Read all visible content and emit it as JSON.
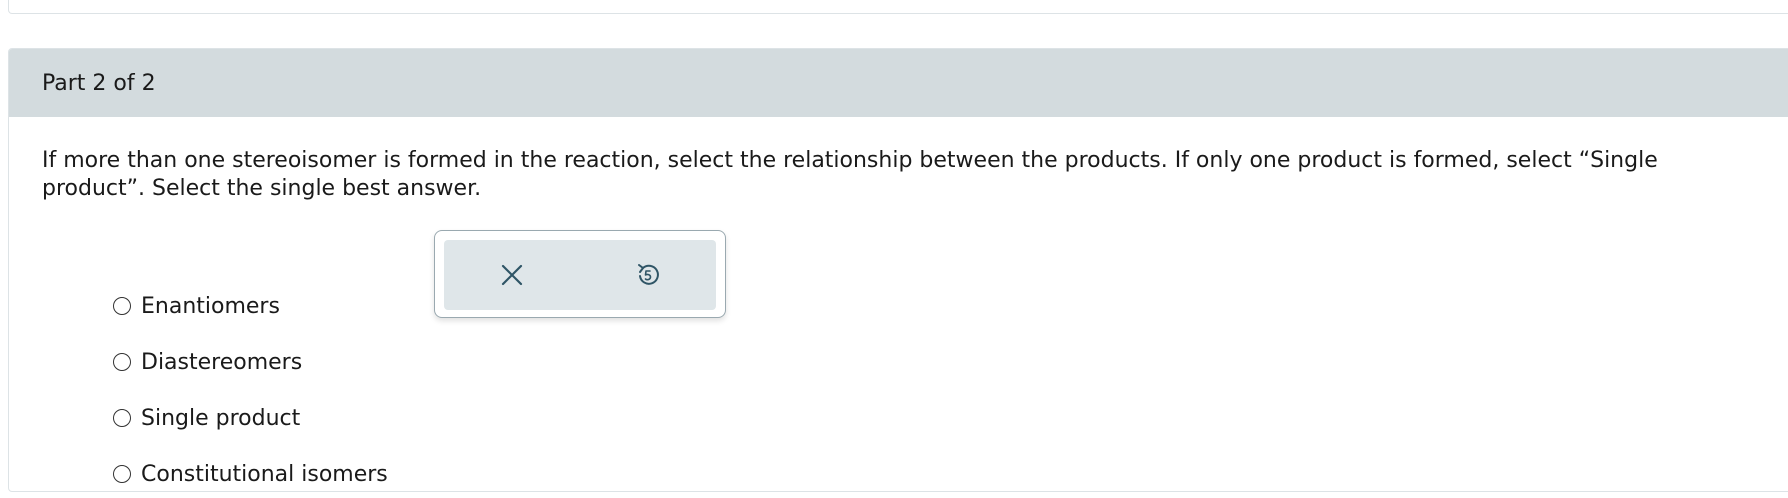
{
  "part": {
    "header": "Part 2 of 2"
  },
  "question": {
    "text": "If more than one stereoisomer is formed in the reaction, select the relationship between the products. If only one product is formed, select “Single product”. Select the single best answer."
  },
  "options": [
    {
      "label": "Enantiomers"
    },
    {
      "label": "Diastereomers"
    },
    {
      "label": "Single product"
    },
    {
      "label": "Constitutional isomers"
    }
  ],
  "tools": {
    "clear_icon": "close-icon",
    "undo_icon": "undo-icon"
  },
  "colors": {
    "header_bg": "#d3dbde",
    "tool_bg": "#dfe6e9",
    "icon": "#2f5566"
  }
}
